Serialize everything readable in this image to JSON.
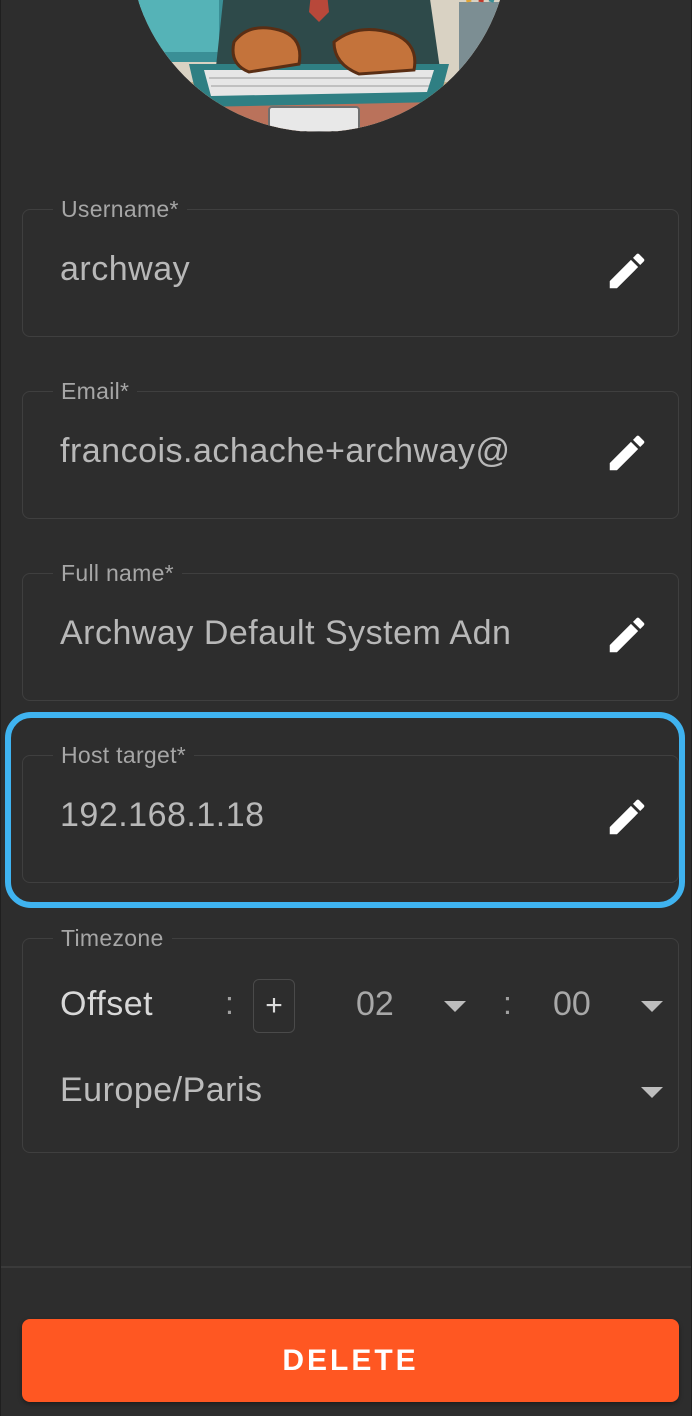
{
  "avatar": {
    "alt": "user avatar illustration"
  },
  "fields": {
    "username": {
      "label": "Username*",
      "value": "archway"
    },
    "email": {
      "label": "Email*",
      "value": "francois.achache+archway@"
    },
    "full_name": {
      "label": "Full name*",
      "value": "Archway Default System Adn"
    },
    "host_target": {
      "label": "Host target*",
      "value": "192.168.1.18"
    }
  },
  "timezone": {
    "label": "Timezone",
    "offset_label": "Offset",
    "colon": ":",
    "sign": "+",
    "hours": "02",
    "minutes": "00",
    "zone": "Europe/Paris"
  },
  "actions": {
    "delete_label": "DELETE"
  },
  "colors": {
    "accent": "#ff5722",
    "highlight": "#3fb3f0",
    "panel": "#2d2d2d"
  },
  "icons": {
    "edit": "pencil-icon",
    "dropdown": "caret-down-icon"
  }
}
